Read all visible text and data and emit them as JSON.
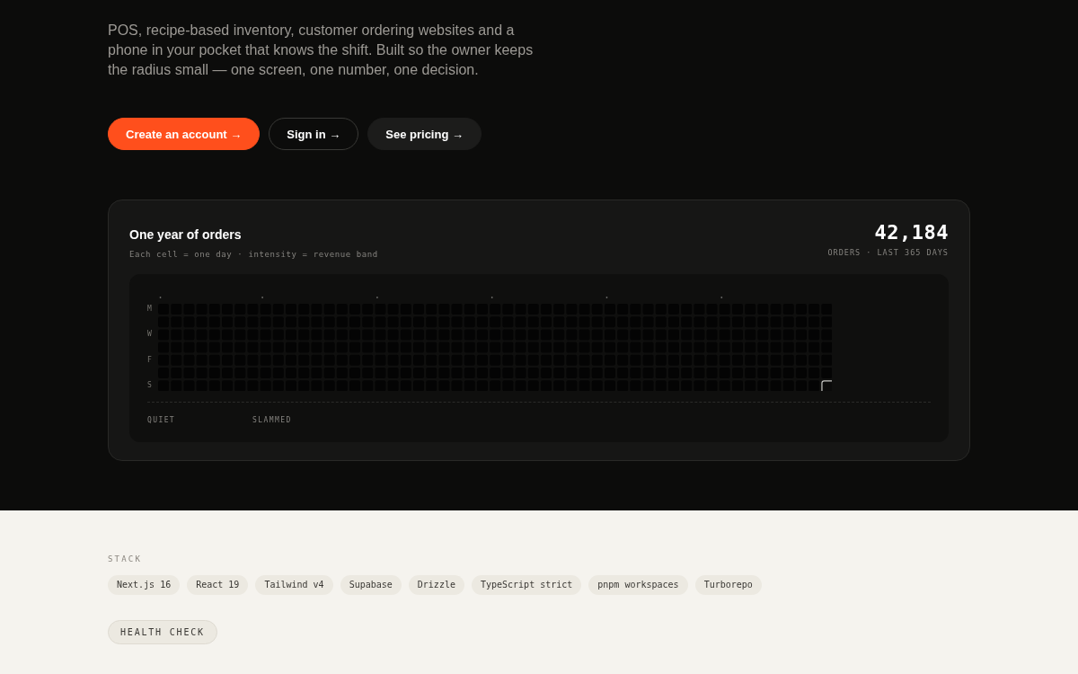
{
  "hero": {
    "description": "POS, recipe-based inventory, customer ordering websites and a phone in your pocket that knows the shift. Built so the owner keeps the radius small — one screen, one number, one decision.",
    "actions": [
      {
        "label": "Create an account →",
        "kind": "primary"
      },
      {
        "label": "Sign in →",
        "kind": "outline"
      },
      {
        "label": "See pricing →",
        "kind": "secondary"
      }
    ]
  },
  "orders_card": {
    "title": "One year of orders",
    "subtitle": "Each cell = one day · intensity = revenue band",
    "total": "42,184",
    "total_caption": "ORDERS · LAST 365 DAYS",
    "heatmap": {
      "day_labels": [
        "M",
        "W",
        "F",
        "S"
      ],
      "today_marked": true
    },
    "legend": [
      "QUIET",
      "SLAMMED"
    ]
  },
  "stack": {
    "label": "STACK",
    "tags": [
      "Next.js 16",
      "React 19",
      "Tailwind v4",
      "Supabase",
      "Drizzle",
      "TypeScript strict",
      "pnpm workspaces",
      "Turborepo"
    ]
  },
  "health_check": {
    "label": "HEALTH CHECK"
  }
}
